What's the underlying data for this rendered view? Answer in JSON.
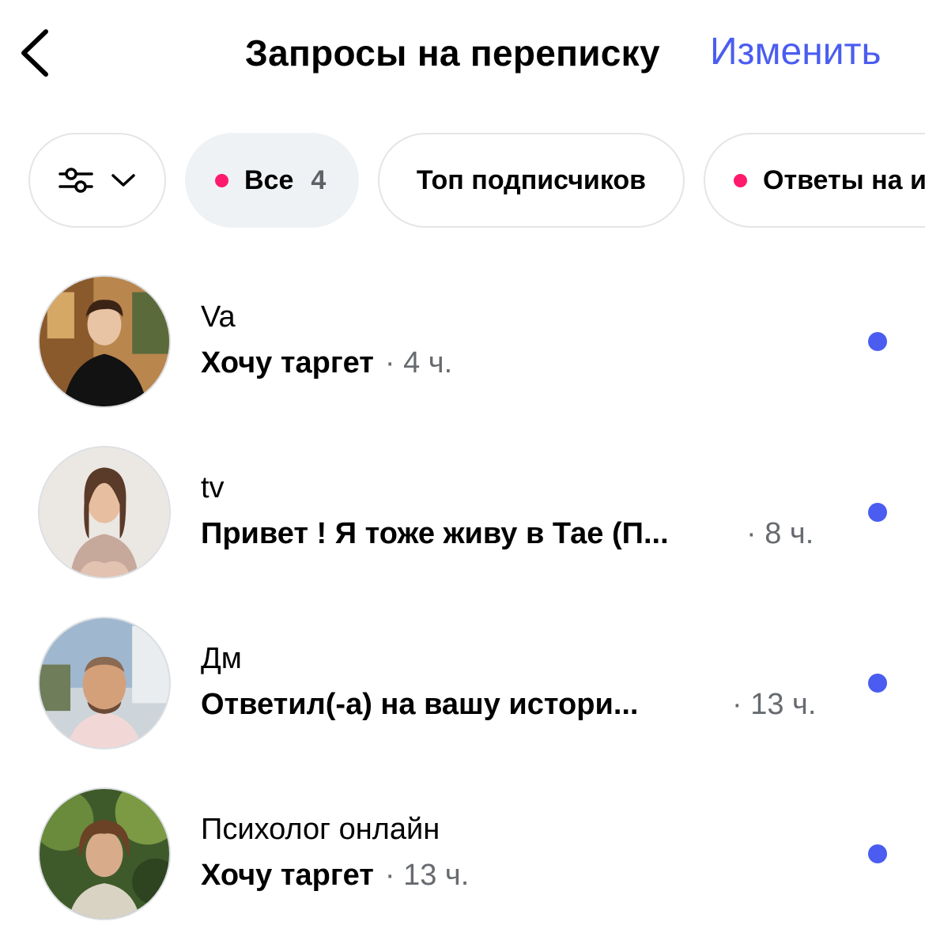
{
  "header": {
    "title": "Запросы на переписку",
    "edit_label": "Изменить"
  },
  "filters": {
    "all_label": "Все",
    "all_count": "4",
    "top_followers_label": "Топ подписчиков",
    "story_replies_label": "Ответы на и"
  },
  "requests": [
    {
      "name": "Va",
      "message": "Хочу таргет",
      "time": "· 4 ч.",
      "unread": true
    },
    {
      "name": "tv",
      "message": "Привет ! Я тоже живу в Тае (П...",
      "time": "· 8 ч.",
      "unread": true
    },
    {
      "name": "Дм",
      "message": "Ответил(-а) на вашу истори...",
      "time": "· 13 ч.",
      "unread": true
    },
    {
      "name": "Психолог онлайн",
      "message": "Хочу таргет",
      "time": "· 13 ч.",
      "unread": true
    }
  ],
  "colors": {
    "accent": "#4a5df0",
    "pink_dot": "#ff1a6d",
    "secondary_text": "#676b70",
    "chip_active_bg": "#eff2f5"
  },
  "icons": {
    "back": "chevron-left-icon",
    "filter": "sliders-icon",
    "dropdown": "chevron-down-icon"
  }
}
